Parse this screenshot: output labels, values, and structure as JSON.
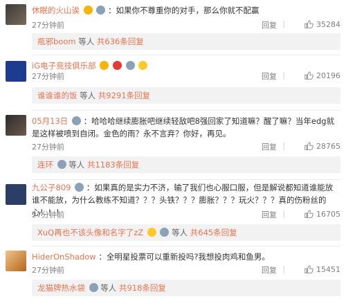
{
  "comments": [
    {
      "user": "休眠的火山诶",
      "text": "：如果你不尊重你的对手，那么你就不配赢",
      "time": "27分钟前",
      "reply": "回复",
      "likes": "35284",
      "sub": {
        "user": "瓶邪boom",
        "deng": " 等人 ",
        "more": "共636条回复"
      }
    },
    {
      "user": "iG电子竞技俱乐部",
      "text": "",
      "time": "27分钟前",
      "reply": "回复",
      "likes": "20196",
      "sub": {
        "user": "谁谁谁的饭",
        "deng": " 等人 ",
        "more": "共9291条回复"
      }
    },
    {
      "user": "05月13日",
      "text": "：哈哈哈继续膨胀吧继续轻敌吧8强回家了知道嘛？醒了嘛？当年edg就是这样被喷到自闭。金色的雨？永不言弃？你好，再见。",
      "time": "27分钟前",
      "reply": "回复",
      "likes": "28765",
      "sub": {
        "user": "连环",
        "deng": " 等人 ",
        "more": "共1183条回复"
      }
    },
    {
      "user": "九公子809",
      "text": "：如果真的是实力不济，输了我们也心服口服，但是解说都知道谁能放谁不能放，为什么教练不知道？？？头铁？？？膨胀？？？玩火？？？真的伤粉丝的心！！！",
      "time": "27分钟前",
      "reply": "回复",
      "likes": "16705",
      "sub": {
        "user": "XuQ再也不该头像和名字了zZ",
        "deng": " 等人 ",
        "more": "共645条回复"
      }
    },
    {
      "user": "HiderOnShadow",
      "text": "：全明星投票可以重新投吗?我想投肉鸡和鱼男。",
      "time": "27分钟前",
      "reply": "回复",
      "likes": "15451",
      "sub": {
        "user": "龙猫牌热水袋",
        "deng": " 等人 ",
        "more": "共918条回复"
      }
    }
  ],
  "colors": {
    "username": "#eb7350",
    "meta": "#808080",
    "subbox": "#f2f2f2"
  }
}
